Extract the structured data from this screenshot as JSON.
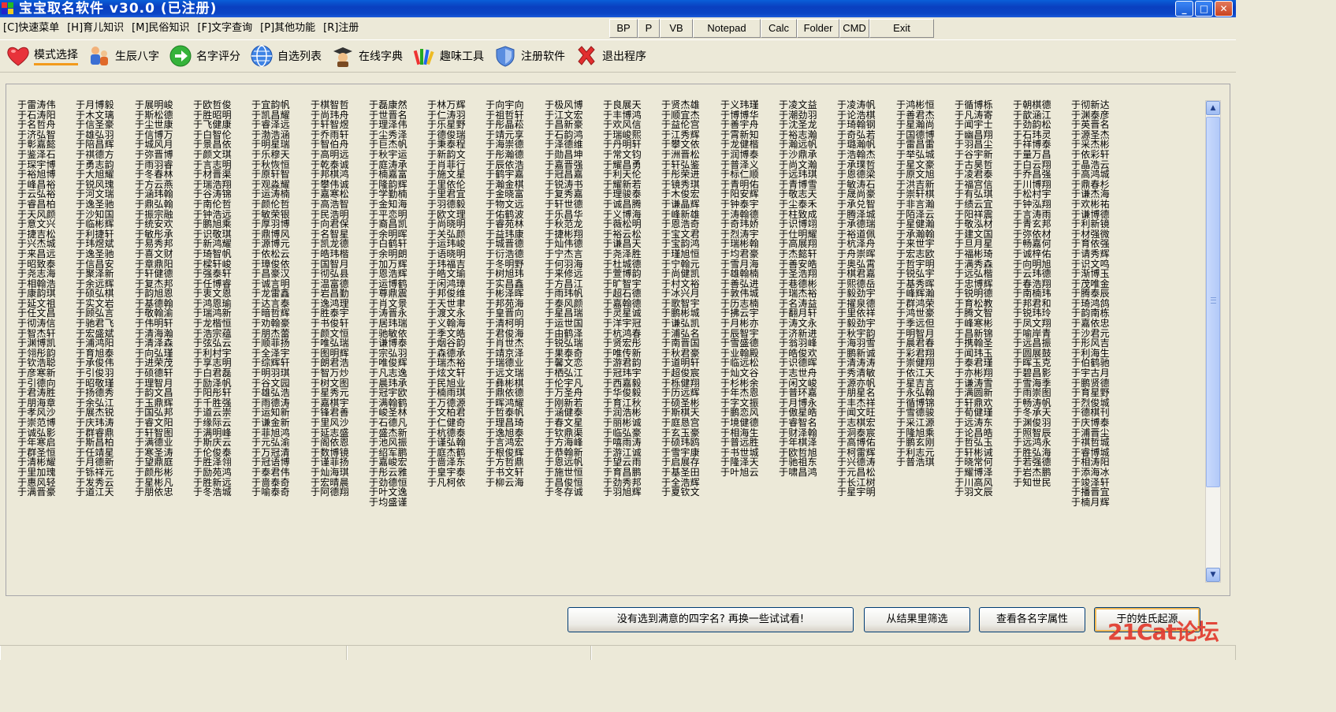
{
  "window": {
    "title": "宝宝取名软件 v30.0 (已注册)",
    "controls": [
      "_",
      "□",
      "✕"
    ]
  },
  "menu": [
    "[C]快速菜单",
    "[H]育儿知识",
    "[M]民俗知识",
    "[F]文字查询",
    "[P]其他功能",
    "[R]注册"
  ],
  "quick_buttons": [
    "BP",
    "P",
    "VB",
    "Notepad",
    "Calc",
    "Folder",
    "CMD",
    "Exit"
  ],
  "toolbar": [
    {
      "label": "模式选择",
      "icon": "heart-icon"
    },
    {
      "label": "生辰八字",
      "icon": "family-icon"
    },
    {
      "label": "名字评分",
      "icon": "green-arrow-icon"
    },
    {
      "label": "自选列表",
      "icon": "globe-icon"
    },
    {
      "label": "在线字典",
      "icon": "graduate-icon"
    },
    {
      "label": "趣味工具",
      "icon": "crayons-icon"
    },
    {
      "label": "注册软件",
      "icon": "shield-icon"
    },
    {
      "label": "退出程序",
      "icon": "red-x-icon"
    }
  ],
  "names": [
    [
      "于雷涛伟",
      "于石涛阳",
      "于名哲舟",
      "于济弘智",
      "于彰嘉懿",
      "于鉴泽石",
      "于琛宇博",
      "于裕旭博",
      "于峰昌裕",
      "于云弘裕",
      "于睿昌柏",
      "于天风颜",
      "于意文兴",
      "于捷吉松",
      "于兴杰城",
      "于来昌远",
      "于昭致泰",
      "于尧志海",
      "于相翰浩",
      "于康韵琪",
      "于延文祖",
      "于任文昌",
      "于彻涛信",
      "于智杰轩",
      "于渊博凯",
      "于翎彤韵",
      "于钦浩聪",
      "于彦寒新",
      "于引德向",
      "于君涛胜",
      "于朋海章",
      "于孝风沙",
      "于崇范博",
      "于诚弘影",
      "于年寒启",
      "于群圣恒",
      "于清彬耀",
      "于里加瑰",
      "于惠风轻",
      "于满晋豪"
    ],
    [
      "于月博毅",
      "于木文璃",
      "于信圣豪",
      "于雄弘羽",
      "于陪昌辉",
      "于祺德方",
      "于勇志韵",
      "于大旭耀",
      "于锐风瑰",
      "于河文瑞",
      "于逸圣驰",
      "于沙知国",
      "于临彬辉",
      "于利捷轩",
      "于玮煜斌",
      "于逸圣驰",
      "于信昌安",
      "于聚泽新",
      "于余远辉",
      "于硕弘棋",
      "于实文岩",
      "于顾弘言",
      "于驰君飞",
      "于宏盛斌",
      "于浦鸿阳",
      "于育旭泰",
      "于承俊伟",
      "于引俊羽",
      "于昭敬瑾",
      "于扬德秀",
      "于余弘江",
      "于展杰锐",
      "于庆玮涛",
      "于群睿鼎",
      "于斯昌柏",
      "于任靖星",
      "于月德新",
      "于铄祥元",
      "于发秀云",
      "于道江天"
    ],
    [
      "于展明峻",
      "于斯松德",
      "于尘世康",
      "于信博万",
      "于城风月",
      "于弥晋博",
      "于雨羽睿",
      "于冬春林",
      "于方云燕",
      "于涵玮翰",
      "于鼎弘翰",
      "于振宗融",
      "于统安欢",
      "于敏彤承",
      "于易秀邦",
      "于喜文财",
      "于章鼎阳",
      "于轩健德",
      "于复杰邦",
      "于韵旭恩",
      "于基德翰",
      "于敬翰渝",
      "于伟明轩",
      "于清海瀚",
      "于清泽森",
      "于向弘瑾",
      "于进荣茂",
      "于硕德轩",
      "于理智月",
      "于韵文昌",
      "于玉鼎辉",
      "于国弘邦",
      "于睿文阳",
      "于轩智图",
      "于满德业",
      "于寒圣涛",
      "于望鼎庭",
      "于颜彤彬",
      "于星彬凡",
      "于朋依忠"
    ],
    [
      "于欧哲俊",
      "于胜昭明",
      "于飞健康",
      "于白智伦",
      "于景昌依",
      "于颜文琪",
      "于言志明",
      "于材晋渠",
      "于瑞浩翔",
      "于谷涛锦",
      "于南伦哲",
      "于钟浩远",
      "于鹏旭乘",
      "于识敬琪",
      "于新鸿耀",
      "于琦智帆",
      "于樑轩峻",
      "于强泰轩",
      "于任博睿",
      "于衷文恩",
      "于鸿恩瑜",
      "于瑞鸿新",
      "于龙楷恒",
      "于浩宗蕴",
      "于弦弘云",
      "于利村宇",
      "于享志明",
      "于白君磊",
      "于励泽帆",
      "于阳彤轩",
      "于千胜强",
      "于道云崇",
      "于缘际云",
      "于满明峰",
      "于斯庆云",
      "于伦俊泰",
      "于胜泽翎",
      "于励苑鸿",
      "于胜新远",
      "于冬浩城"
    ],
    [
      "于宜韵帆",
      "于凯昌耀",
      "于睿泽远",
      "于渤浩涵",
      "于明星瑞",
      "于乐穆天",
      "于秋恢恒",
      "于原轩智",
      "于观淼耀",
      "于运涛楠",
      "于颜伦哲",
      "于敏荣银",
      "于厚羽博",
      "于鼎博风",
      "于源博元",
      "于依松云",
      "于璋俊依",
      "于昌豪汉",
      "于诚言明",
      "于龙雷鑫",
      "于达言泰",
      "于暗哲辉",
      "于劝翰豪",
      "于朋杰蕾",
      "于顺菲扬",
      "于全泽宇",
      "于综辉轩",
      "于明羽琪",
      "于谷文园",
      "于雄弘浩",
      "于雨德涛",
      "于运知新",
      "于谦金新",
      "于菲旭鸿",
      "于元弘渝",
      "于万冠清",
      "于冠语博",
      "于泰君伟",
      "于啬泰奇",
      "于喻泰奇"
    ],
    [
      "于棋智哲",
      "于尚玮舟",
      "于轩智煜",
      "于乔雨轩",
      "于智伯舟",
      "于高明远",
      "于乾泰诚",
      "于邦棋鸿",
      "于攀伟诚",
      "于嘉寒松",
      "于高浩智",
      "于民浩明",
      "于向君保",
      "于名智星",
      "于凯龙德",
      "于皓玮楷",
      "于国智月",
      "于彻弘县",
      "于温富德",
      "于岩昌勤",
      "于逸鸿理",
      "于胜泰宇",
      "于书俊轩",
      "于颜文恒",
      "于唯弘瑞",
      "于图明辉",
      "于朗君浩",
      "于智万炒",
      "于树文图",
      "于星秀元",
      "于嘉棋宇",
      "于锋君善",
      "于里风沙",
      "于延志盛",
      "于阁依恩",
      "于数博镜",
      "于谨菲扬",
      "于灿海琪",
      "于宏晴晨",
      "于阿德翔"
    ],
    [
      "于磊康然",
      "于世晋名",
      "于理泽伟",
      "于尘秀泽",
      "于巨杰帆",
      "于秋宇运",
      "于庭涛承",
      "于楠嘉富",
      "于隆韵辉",
      "于学勤楠",
      "于金知海",
      "于平恋明",
      "于裔昌凯",
      "于余明晖",
      "于白鹤轩",
      "于余明朗",
      "于加万辉",
      "于恩浩辉",
      "于运博鹤",
      "于尊鼎震",
      "于肖文景",
      "于涛晋永",
      "于居玮瑞",
      "于驰敏依",
      "于谦博泰",
      "于宗弘羽",
      "于唯俊辉",
      "于凡志逸",
      "于晨玮承",
      "于冠宇欧",
      "于满翰鹤",
      "于峻圣林",
      "于石德凡",
      "于盛杰新",
      "于池风振",
      "于绍军鹏",
      "于嘉峻宏",
      "于彤云雅",
      "于劲德恒",
      "于叶文逸",
      "于均盛谨"
    ],
    [
      "于林万辉",
      "于仁涛羽",
      "于乐星野",
      "于德俊瑞",
      "于秉泰程",
      "于新韵文",
      "于肖菲行",
      "于施文星",
      "于里依伦",
      "于里君宜",
      "于羽德毅",
      "于欧文理",
      "于尚晓明",
      "于关弘颜",
      "于运玮峻",
      "于语晓明",
      "于玮福吉",
      "于皓文瑜",
      "于闲鸿璋",
      "于邦俊维",
      "于天世聿",
      "于渡文永",
      "于义翰海",
      "于季文皓",
      "于烟谷韵",
      "于森德承",
      "于瑞杰裕",
      "于炫文轩",
      "于民旭业",
      "于楠雨琪",
      "于万德源",
      "于文柏君",
      "于仁健奇",
      "于杭德泰",
      "于谨弘翰",
      "于庭杰鹤",
      "于啬泽东",
      "于皇宇泰",
      "于凡柯依"
    ],
    [
      "于向宇向",
      "于祖哲轩",
      "于彤晶菘",
      "于靖元享",
      "于海崇德",
      "于彤瀚德",
      "于辰依浩",
      "于鹤宇嘉",
      "于瀚金棋",
      "于金晓富",
      "于物文远",
      "于佑鹤波",
      "于睿苑林",
      "于益玮康",
      "于城晋德",
      "于衍浩德",
      "于冬明野",
      "于树旭玮",
      "于实昌鑫",
      "于彬泽晖",
      "于邦苑海",
      "于皇晋向",
      "于清柯明",
      "于君俊海",
      "于肖世杰",
      "于靖京泽",
      "于瑞德业",
      "于远文瑞",
      "于彝彬棋",
      "于鼎依德",
      "于晖鸿耀",
      "于哲泰帆",
      "于理昌琦",
      "于逸旭泰",
      "于言鸿宏",
      "于根俊辉",
      "于方哲鼎",
      "于书文轩",
      "于柳云海"
    ],
    [
      "于极风博",
      "于江文宏",
      "于昌新豪",
      "于石韵鸿",
      "于泽德维",
      "于勋昌坤",
      "于嘉晋强",
      "于冠昌嘉",
      "于锐涛书",
      "于复秀嘉",
      "于轩世德",
      "于乐昌华",
      "于秋范龙",
      "于捷彬翔",
      "于灿伟德",
      "于宁杰言",
      "于何羽海",
      "于来修远",
      "于方昌江",
      "于雨玮帆",
      "于泰风颜",
      "于星昌瑞",
      "于运世国",
      "于由鹤泽",
      "于锐弘瑞",
      "于果泰奇",
      "于馨文恋",
      "于栖弘江",
      "于伦宇凡",
      "于万圣舟",
      "于刚新若",
      "于涵健泰",
      "于春文星",
      "于钦鼎渠",
      "于方海峰",
      "于恭翰新",
      "于恩远帆",
      "于施世恒",
      "于昌俊恒",
      "于冬存诚"
    ],
    [
      "于良展天",
      "于丰博鸿",
      "于欢风信",
      "于瑞峻熙",
      "于丹明轩",
      "于常文钧",
      "于耀昌勇",
      "于利天伦",
      "于耀新若",
      "于理骏泰",
      "于诚昌腾",
      "于义博海",
      "于薇松明",
      "于裕云松",
      "于谦昌天",
      "于尧泽胜",
      "于杜城德",
      "于萱博韵",
      "于旷智宇",
      "于超石德",
      "于嘉翰德",
      "于灵星诚",
      "于洋宇冠",
      "于杭鸿春",
      "于贤宏彤",
      "于唯传新",
      "于游君韵",
      "于冠玮宇",
      "于西嘉毅",
      "于华俊毅",
      "于育江秋",
      "于润浩彬",
      "于丽彬诚",
      "于临弘豪",
      "于嘻雨涛",
      "于游江诚",
      "于望云雨",
      "于育昌鹏",
      "于劲秀邦",
      "于羽旭辉"
    ],
    [
      "于贤杰雄",
      "于顺宜杰",
      "于益伦宫",
      "于江秀辉",
      "于攀文依",
      "于洲晋松",
      "于轩弘鉴",
      "于彤荣进",
      "于镜秀琪",
      "于木俊宏",
      "于谦晶辉",
      "于峰新雄",
      "于恩浩奇",
      "于宝文君",
      "于宝韵鸿",
      "于瑾旭恒",
      "于宁翰元",
      "于尚健凯",
      "于村文裕",
      "于冰兴月",
      "于歌智宇",
      "于鹏彬城",
      "于谦弘凯",
      "于浦弘名",
      "于南晋国",
      "于秋君豪",
      "于道明轩",
      "于超俊宸",
      "于栎健翔",
      "于历远辉",
      "于硕圣彬",
      "于斯棋天",
      "于庭恳宫",
      "于玄玉豪",
      "于硕玮鸥",
      "于雪宇康",
      "于启展存",
      "于基圣田",
      "于全浩辉",
      "于夏钦文"
    ],
    [
      "于义玮瑾",
      "于博博华",
      "于善宇舟",
      "于霄新知",
      "于龙健楷",
      "于润博泰",
      "于普泽义",
      "于标仁顺",
      "于青明佑",
      "于阳安辉",
      "于钟泰宇",
      "于涛翰德",
      "于奇玮娇",
      "于烈涛宇",
      "于瑞彬翰",
      "于均君豪",
      "于雪月海",
      "于雄翰楠",
      "于善弘进",
      "于敦伟城",
      "于历志楠",
      "于拂云宇",
      "于月彬亦",
      "于辰智宇",
      "于雪盛德",
      "于业翰殿",
      "于临远松",
      "于灿文谷",
      "于杉彬余",
      "于年杰恩",
      "于字文振",
      "于鹏恋风",
      "于境健德",
      "于相海生",
      "于普远胜",
      "于书世城",
      "于隆泽天",
      "于叶旭云"
    ],
    [
      "于凌文益",
      "于潮劲羽",
      "于沈圣龙",
      "于裕志瀚",
      "于瀚远帆",
      "于沙鼎承",
      "于尚文瀚",
      "于远玮琪",
      "于青博雪",
      "于敬志天",
      "于尘泰禾",
      "于柱致成",
      "于识博翊",
      "于仕明耀",
      "于高展翔",
      "于杰懿轩",
      "于善安皓",
      "于圣浩翔",
      "于巷德彬",
      "于瑞杰裕",
      "于名涛益",
      "于翻月轩",
      "于涛文永",
      "于济新进",
      "于翁羽峰",
      "于皓俊欢",
      "于识德晖",
      "于志世舟",
      "于闲文峻",
      "于普环嘉",
      "于月博永",
      "于傲星皓",
      "于睿智名",
      "于财泽翰",
      "于年棋泽",
      "于欧哲旭",
      "于驰祖东",
      "于啸昌鸿"
    ],
    [
      "于凌涛帆",
      "于论浩棋",
      "于琦翰钢",
      "于奇弘若",
      "于璐瀚帆",
      "于浩翰杰",
      "于承璞哲",
      "于恩德梁",
      "于敏涛石",
      "于晟尚豪",
      "于承兑智",
      "于腾泽城",
      "于承德瑞",
      "于裕道佩",
      "于杭泽舟",
      "于舟崇晖",
      "于奥弘霄",
      "于棋君嘉",
      "于熙德岳",
      "于毅劲宇",
      "于擢泉德",
      "于里依祥",
      "于毅劲宇",
      "于秋宇韵",
      "于海羽雪",
      "于鹏新诚",
      "于清涛涛",
      "于秀清敏",
      "于源亦帆",
      "于朋星名",
      "于丰杰祥",
      "于闻文旺",
      "于志棋宏",
      "于洞泰宸",
      "于高博佑",
      "于柯雷辉",
      "于兴德涛",
      "于元昌松",
      "于长江树",
      "于星宇明"
    ],
    [
      "于鸿彬恒",
      "于善君杰",
      "于星瀚尚",
      "于国德博",
      "于雷昌雷",
      "于举弘城",
      "于星文豪",
      "于原文旭",
      "于洪吉新",
      "于崇轩棋",
      "于非言瀚",
      "于陌泽云",
      "于星健瀚",
      "于承瀚翰",
      "于来世宇",
      "于宏志欧",
      "于哲宇明",
      "于锐弘宇",
      "于基秀晖",
      "于峰辉瀚",
      "于群鸿荣",
      "于鸿世豪",
      "于季远但",
      "于明智月",
      "于晨君春",
      "于彩君翔",
      "于崇健翔",
      "于依江天",
      "于星吉言",
      "于永弘翰",
      "于循博锦",
      "于雪德骏",
      "于采江源",
      "于隆旭乘",
      "于鹏玄刚",
      "于利志元",
      "于普浩琪"
    ],
    [
      "于循博栎",
      "于凡涛寄",
      "于闻宇士",
      "于幽昌翔",
      "于羽昌尘",
      "于谷宇新",
      "于古昊哲",
      "于凌君泰",
      "于福宫信",
      "于有弘琪",
      "于绩云宜",
      "于阳祥震",
      "于敬泓材",
      "于建文国",
      "于旦月星",
      "于福彬琦",
      "于满秀森",
      "于远弘楷",
      "于忠博辉",
      "于锐明德",
      "于育松教",
      "于腾文智",
      "于峰寒彬",
      "于昌新锦",
      "于携翰圣",
      "于闻玮玉",
      "于泰君瑾",
      "于亦彬翔",
      "于谦涛雪",
      "于满圆新",
      "于轩鼎欢",
      "于荀健瑾",
      "于远涛东",
      "于论昌皓",
      "于哲弘玉",
      "于轩彬诫",
      "于晓常何",
      "于耀博泽",
      "于川高风",
      "于羽文辰"
    ],
    [
      "于朝棋德",
      "于歆涵江",
      "于劲韵松",
      "于石玮灵",
      "于祥博泰",
      "于量万昌",
      "于白云翔",
      "于乔昌强",
      "于川博翔",
      "于松村宇",
      "于钟泓翔",
      "于言涛雨",
      "于青玄邦",
      "于弥依材",
      "于畅嘉何",
      "于诚梓佑",
      "于向明旭",
      "于云玮德",
      "于春浩翔",
      "于南楠玮",
      "于邦君和",
      "于锐玮玲",
      "于凤文翔",
      "于喻岸青",
      "于远昌振",
      "于圆展鼓",
      "于晖玉克",
      "于碧昌影",
      "于雪海季",
      "于雨崇图",
      "于畅涛帆",
      "于冬承天",
      "于渊俊羽",
      "于照智辰",
      "于远鸿永",
      "于胜弘海",
      "于若强德",
      "于岩杰鹏",
      "于知世民"
    ],
    [
      "于彻新达",
      "于渊泰彦",
      "于英晋名",
      "于源圣杰",
      "于采杰彬",
      "于依彩轩",
      "于晶浩云",
      "于高鸿城",
      "于鼎春杉",
      "于谦杰海",
      "于欢彬祐",
      "于谦博德",
      "于利新镜",
      "于材强微",
      "于育依强",
      "于请秀辉",
      "于识文鸣",
      "于渐博玉",
      "于茂唯金",
      "于腾泰辰",
      "于琦鸿鸽",
      "于韵南栋",
      "于嘉依忠",
      "于沙君元",
      "于形风吉",
      "于利海生",
      "于伯鹤驰",
      "于宇古月",
      "于鹏贤德",
      "于育星野",
      "于烈俊城",
      "于德棋刊",
      "于庆博泰",
      "于浦晋尘",
      "于祺哲城",
      "于睿博城",
      "于相涛阳",
      "于添海冰",
      "于竣泽轩",
      "于播晋宜",
      "于楠月辉"
    ]
  ],
  "buttons": {
    "another_batch": "没有选到满意的四字名? 再换一些试试看!",
    "filter": "从结果里筛选",
    "attributes": "查看各名字属性",
    "origin": "于的姓氏起源"
  },
  "watermark": "21Cat论坛",
  "colors": {
    "title_bar": "#0A4FCF",
    "accent_underline": "#F29A1B",
    "window_bg": "#ECE9D8"
  }
}
